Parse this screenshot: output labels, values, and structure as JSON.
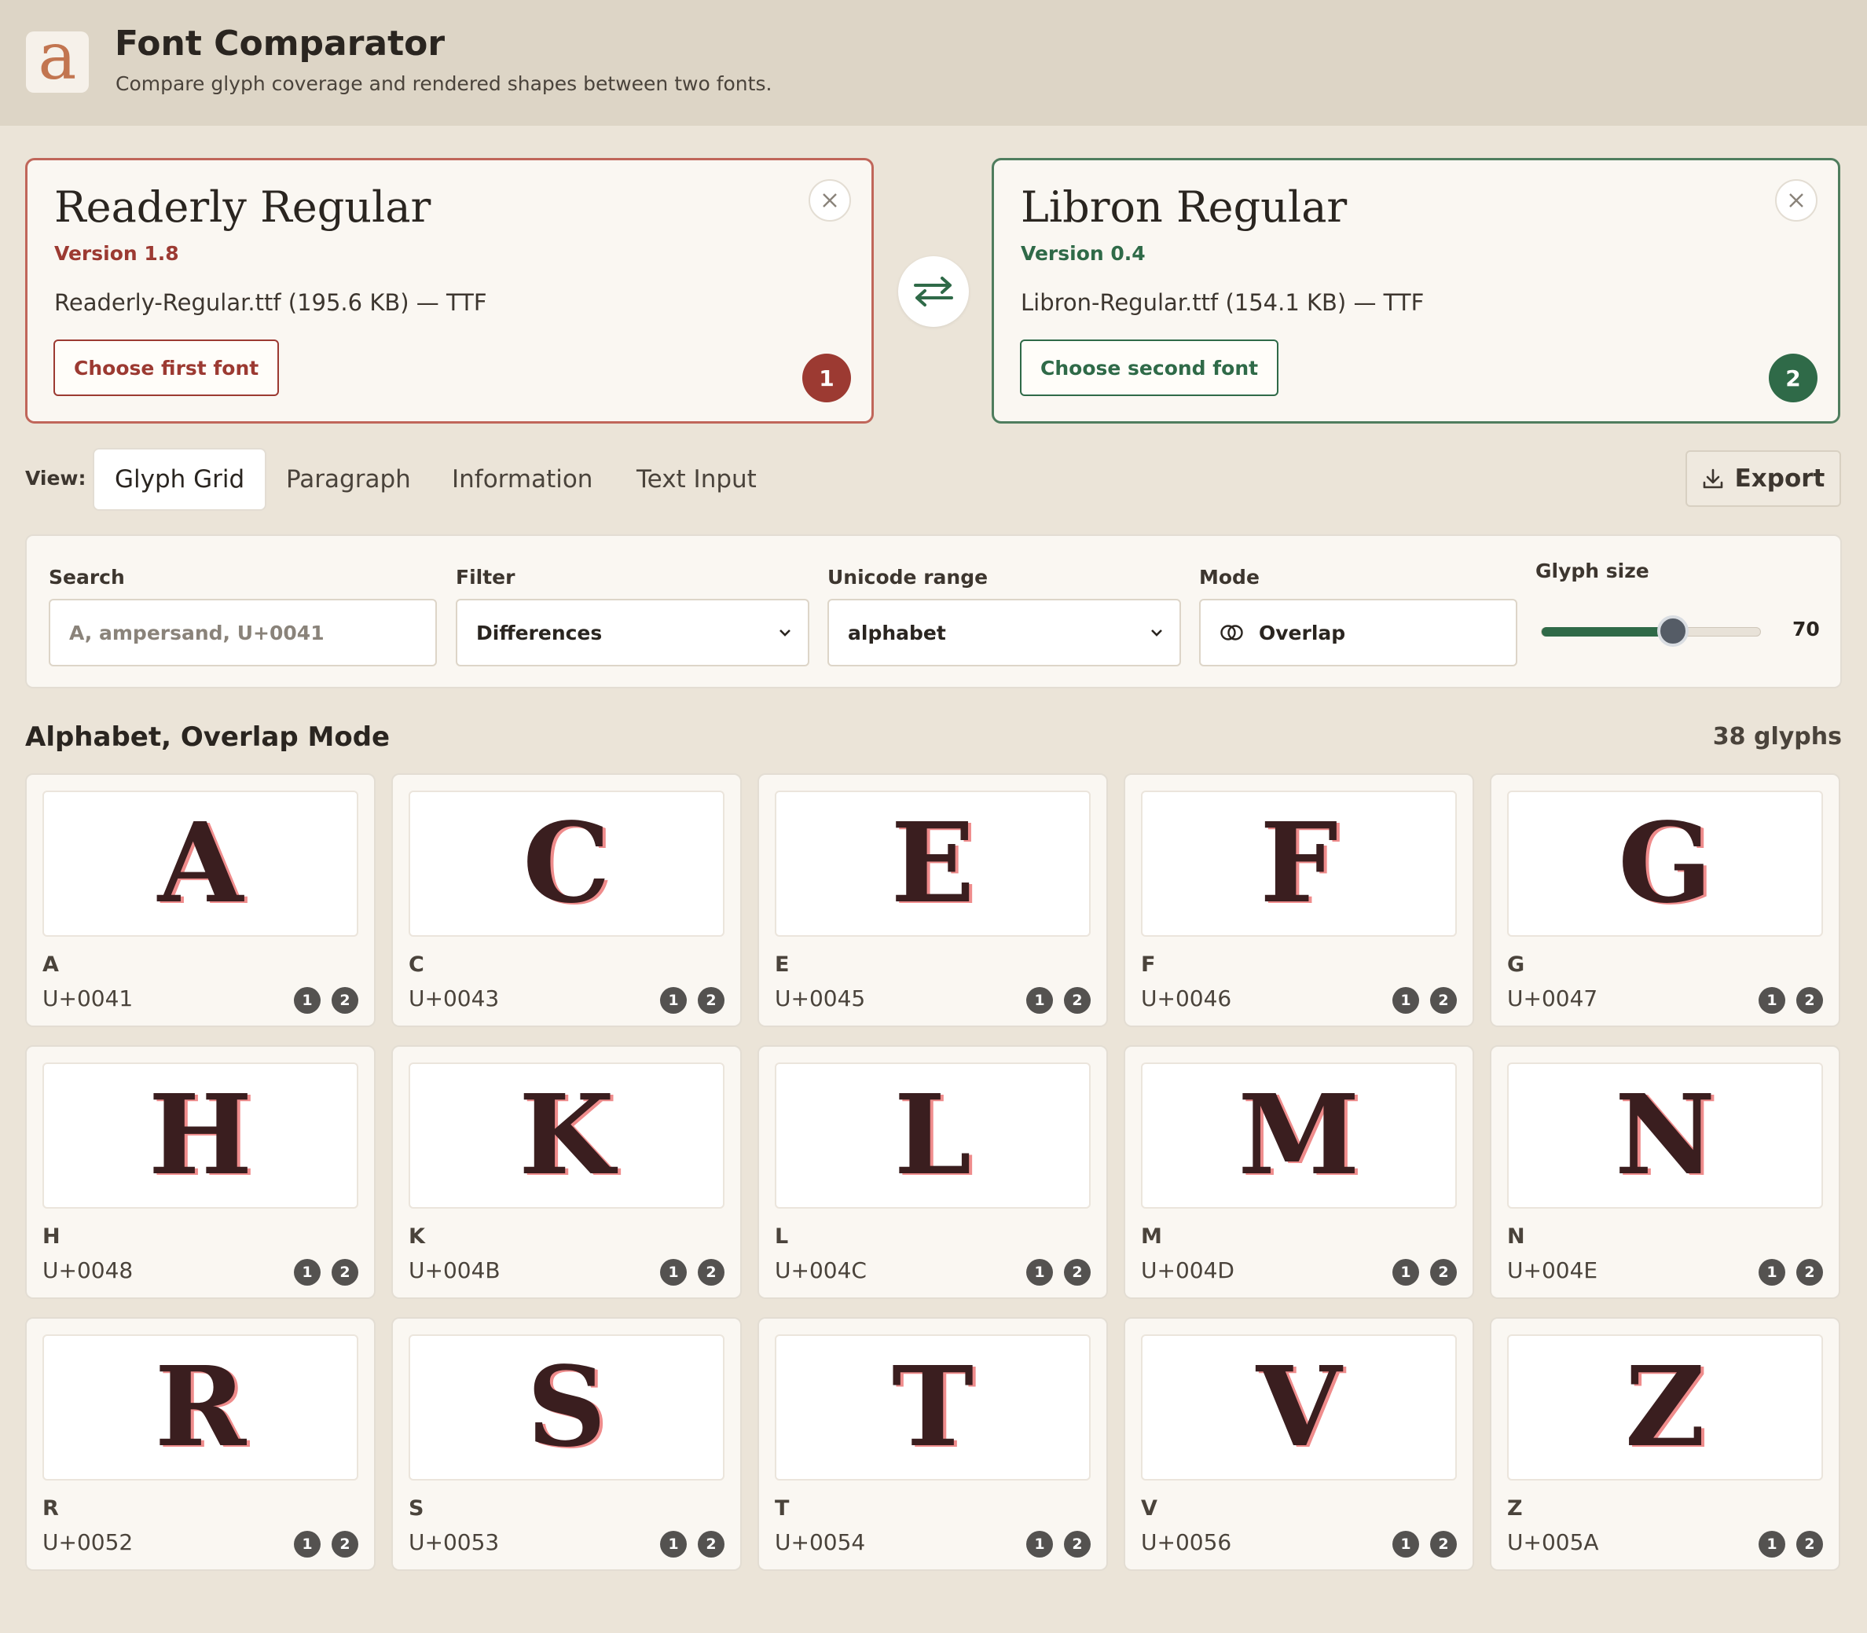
{
  "app": {
    "logo_letter": "a",
    "title": "Font Comparator",
    "subtitle": "Compare glyph coverage and rendered shapes between two fonts."
  },
  "fonts": [
    {
      "name": "Readerly Regular",
      "version": "Version 1.8",
      "file": "Readerly-Regular.ttf (195.6 KB) — TTF",
      "button": "Choose first font",
      "badge": "1",
      "accent": "#9c3a32"
    },
    {
      "name": "Libron Regular",
      "version": "Version 0.4",
      "file": "Libron-Regular.ttf (154.1 KB) — TTF",
      "button": "Choose second font",
      "badge": "2",
      "accent": "#2f6a48"
    }
  ],
  "view": {
    "label": "View:",
    "tabs": [
      "Glyph Grid",
      "Paragraph",
      "Information",
      "Text Input"
    ],
    "active_tab": "Glyph Grid",
    "export_label": "Export"
  },
  "controls": {
    "search": {
      "label": "Search",
      "placeholder": "A, ampersand, U+0041",
      "value": ""
    },
    "filter": {
      "label": "Filter",
      "value": "Differences"
    },
    "range": {
      "label": "Unicode range",
      "value": "alphabet"
    },
    "mode": {
      "label": "Mode",
      "value": "Overlap"
    },
    "glyph_size": {
      "label": "Glyph size",
      "value": "70",
      "fraction": 0.6
    }
  },
  "grid": {
    "title": "Alphabet, Overlap Mode",
    "count": "38 glyphs",
    "badge1": "1",
    "badge2": "2",
    "glyphs": [
      {
        "char": "A",
        "code": "U+0041"
      },
      {
        "char": "C",
        "code": "U+0043"
      },
      {
        "char": "E",
        "code": "U+0045"
      },
      {
        "char": "F",
        "code": "U+0046"
      },
      {
        "char": "G",
        "code": "U+0047"
      },
      {
        "char": "H",
        "code": "U+0048"
      },
      {
        "char": "K",
        "code": "U+004B"
      },
      {
        "char": "L",
        "code": "U+004C"
      },
      {
        "char": "M",
        "code": "U+004D"
      },
      {
        "char": "N",
        "code": "U+004E"
      },
      {
        "char": "R",
        "code": "U+0052"
      },
      {
        "char": "S",
        "code": "U+0053"
      },
      {
        "char": "T",
        "code": "U+0054"
      },
      {
        "char": "V",
        "code": "U+0056"
      },
      {
        "char": "Z",
        "code": "U+005A"
      }
    ],
    "overlap_colors": {
      "font1": "#3a1e1f",
      "font2": "#ef8c8c"
    }
  }
}
